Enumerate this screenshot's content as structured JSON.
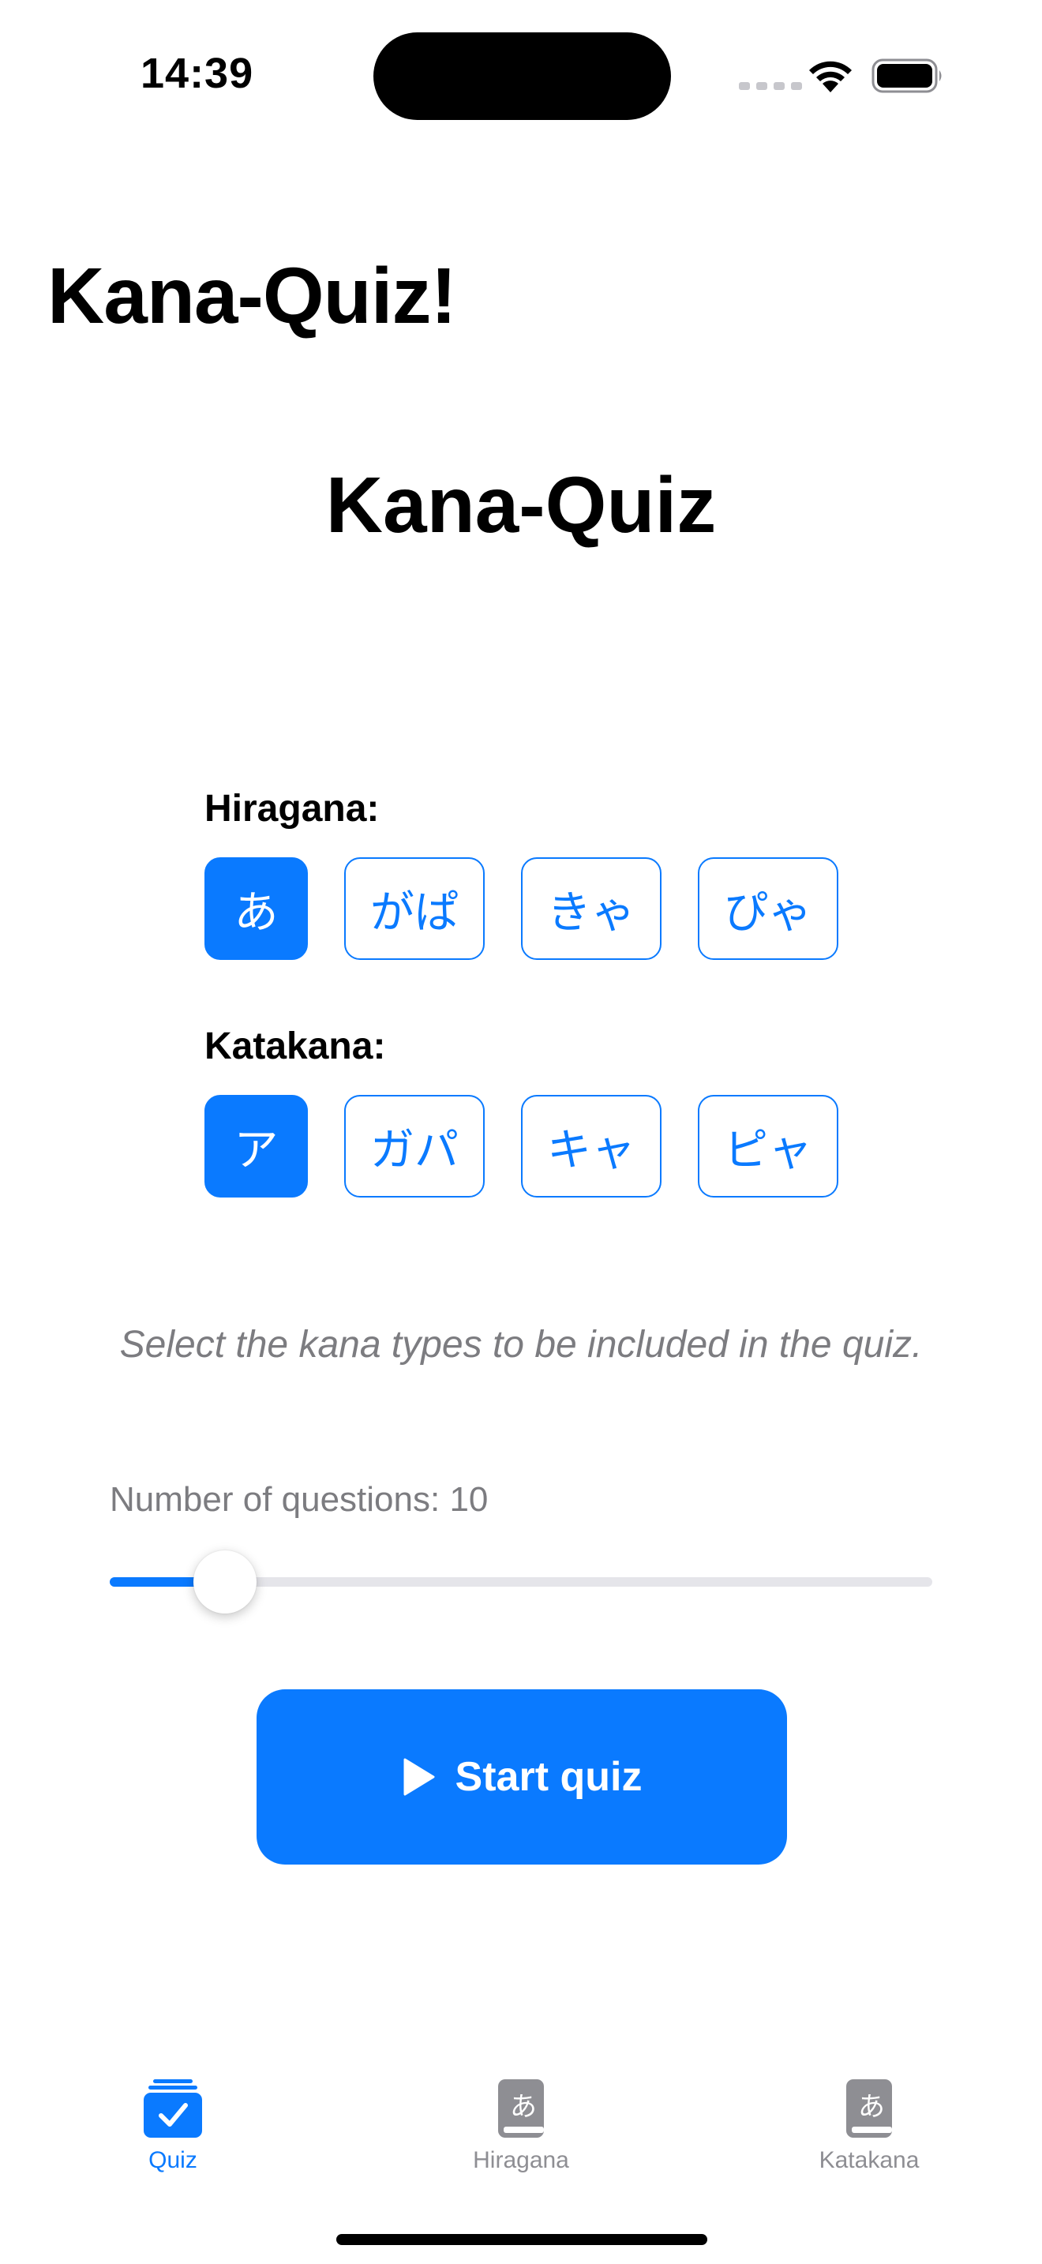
{
  "status_bar": {
    "time": "14:39"
  },
  "nav": {
    "title": "Kana-Quiz!"
  },
  "page": {
    "title": "Kana-Quiz"
  },
  "hiragana": {
    "label": "Hiragana:",
    "options": [
      {
        "text": "あ",
        "selected": true
      },
      {
        "text": "がぱ",
        "selected": false
      },
      {
        "text": "きゃ",
        "selected": false
      },
      {
        "text": "ぴゃ",
        "selected": false
      }
    ]
  },
  "katakana": {
    "label": "Katakana:",
    "options": [
      {
        "text": "ア",
        "selected": true
      },
      {
        "text": "ガパ",
        "selected": false
      },
      {
        "text": "キャ",
        "selected": false
      },
      {
        "text": "ピャ",
        "selected": false
      }
    ]
  },
  "hint": "Select the kana types to be included in the quiz.",
  "questions": {
    "label": "Number of questions: 10",
    "value": 10,
    "fraction": 0.14
  },
  "start_button": {
    "label": "Start quiz"
  },
  "tabs": [
    {
      "label": "Quiz",
      "icon": "quiz-stack-check-icon",
      "active": true
    },
    {
      "label": "Hiragana",
      "icon": "hiragana-book-icon",
      "active": false
    },
    {
      "label": "Katakana",
      "icon": "katakana-book-icon",
      "active": false
    }
  ],
  "colors": {
    "accent": "#0a7aff",
    "secondary_text": "#7c7c80",
    "inactive_tab": "#8e8e93"
  }
}
